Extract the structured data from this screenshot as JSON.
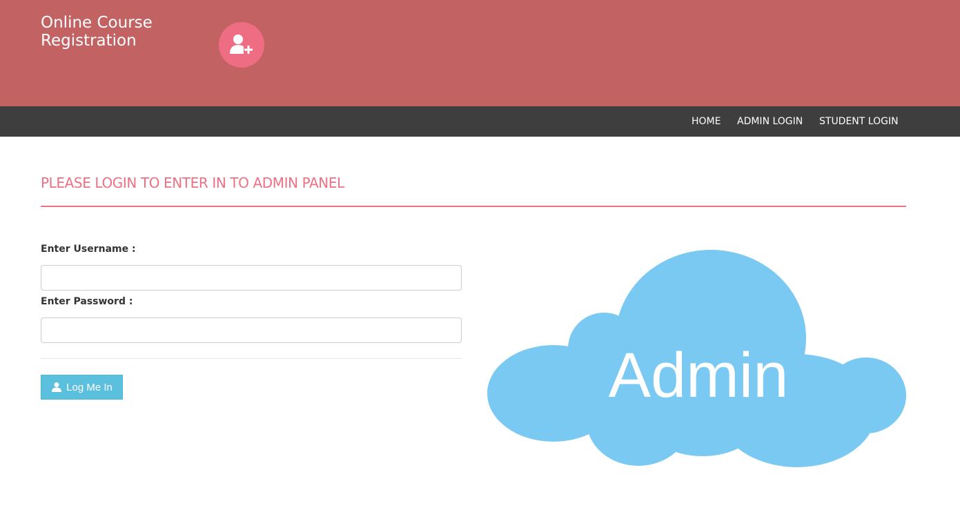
{
  "header": {
    "brand_title": "Online Course Registration",
    "logo_icon": "user-plus-icon",
    "background_color": "#c26262",
    "logo_color": "#ee6d82"
  },
  "navbar": {
    "items": [
      {
        "label": "HOME"
      },
      {
        "label": "ADMIN LOGIN"
      },
      {
        "label": "STUDENT LOGIN"
      }
    ],
    "background_color": "#3e3e3e"
  },
  "main": {
    "heading": "PLEASE LOGIN TO ENTER IN TO ADMIN PANEL",
    "accent_color": "#ef6f83",
    "form": {
      "username_label": "Enter Username :",
      "username_value": "",
      "password_label": "Enter Password :",
      "password_value": "",
      "submit_label": "Log Me In",
      "submit_icon": "user-icon",
      "button_color": "#5bc0de"
    },
    "illustration": {
      "text": "Admin",
      "cloud_color": "#79c9f3"
    }
  }
}
